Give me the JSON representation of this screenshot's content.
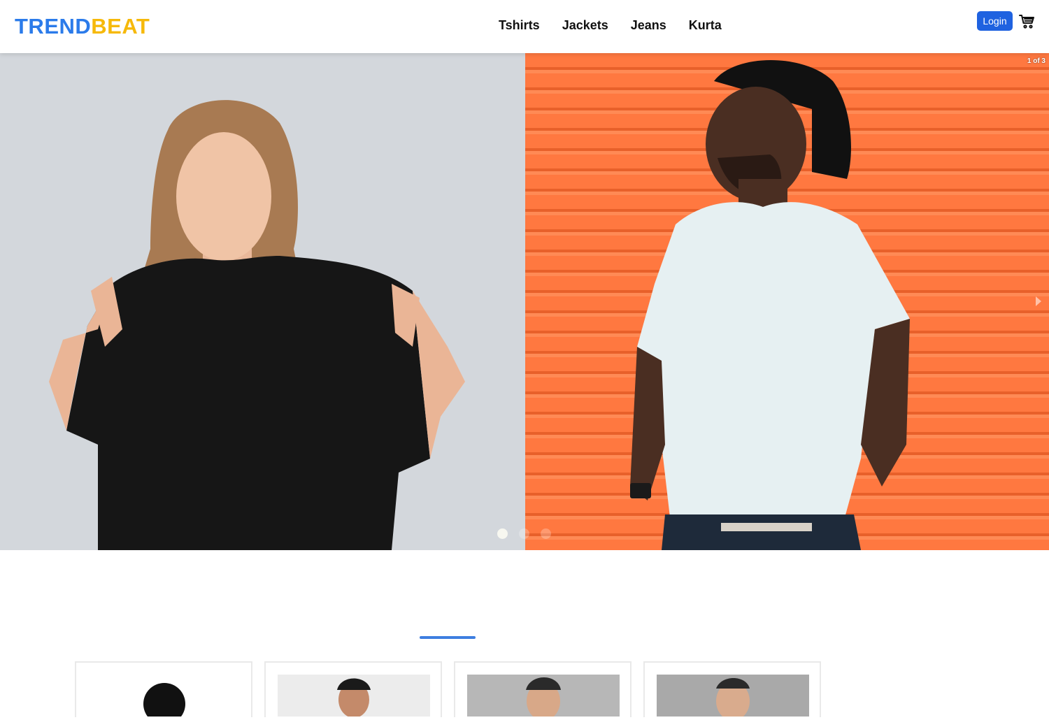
{
  "brand": {
    "part1": "TREND",
    "part2": "BEAT",
    "color1": "#2b7bea",
    "color2": "#f6b90a"
  },
  "nav": {
    "items": [
      "Tshirts",
      "Jackets",
      "Jeans",
      "Kurta"
    ]
  },
  "header": {
    "login_label": "Login",
    "cart_icon": "cart-icon"
  },
  "carousel": {
    "counter": "1 of 3",
    "total_slides": 3,
    "active_slide": 1,
    "slides": [
      {
        "subject": "woman in black oversized t-shirt",
        "background": "#d3d7dc"
      },
      {
        "subject": "man in white t-shirt and black cap",
        "background": "#ff7840"
      }
    ]
  },
  "section": {
    "accent_color": "#3d7ee0"
  },
  "product_cards": [
    {
      "image": "model-portrait"
    },
    {
      "image": "model-portrait"
    },
    {
      "image": "model-portrait"
    },
    {
      "image": "model-portrait"
    }
  ]
}
